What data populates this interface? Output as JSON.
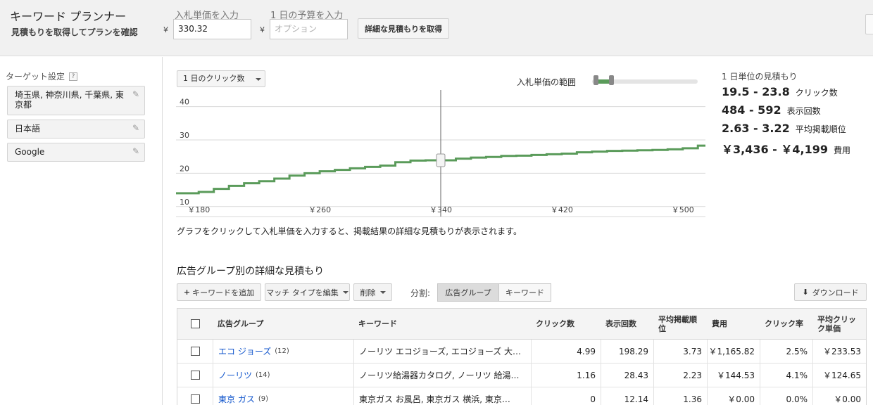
{
  "header": {
    "title": "キーワード プランナー",
    "subtitle": "見積もりを取得してプランを確認",
    "bid_label": "入札単価を入力",
    "budget_label": "1 日の予算を入力",
    "currency": "¥",
    "bid_value": "330.32",
    "budget_placeholder": "オプション",
    "detail_button": "詳細な見積もりを取得"
  },
  "sidebar": {
    "heading": "ターゲット設定",
    "help": "?",
    "items": [
      {
        "label": "埼玉県, 神奈川県, 千葉県, 東京都"
      },
      {
        "label": "日本語"
      },
      {
        "label": "Google"
      }
    ]
  },
  "controls": {
    "metric_dropdown": "1 日のクリック数",
    "range_label": "入札単価の範囲",
    "range_min_fraction": 0.03,
    "range_max_fraction": 0.18
  },
  "chart_data": {
    "type": "line",
    "title": "",
    "xlabel": "",
    "ylabel": "",
    "xlim": [
      165,
      515
    ],
    "ylim": [
      7,
      45
    ],
    "x_tick_labels": [
      "￥180",
      "￥260",
      "￥340",
      "￥420",
      "￥500"
    ],
    "x_ticks": [
      180,
      260,
      340,
      420,
      500
    ],
    "y_ticks": [
      10,
      20,
      30,
      40
    ],
    "grid": true,
    "current_bid": 340,
    "color": "#5a9b5a",
    "series": [
      {
        "x": [
          165,
          180,
          190,
          200,
          210,
          220,
          230,
          240,
          250,
          260,
          270,
          280,
          290,
          300,
          310,
          320,
          330,
          340,
          350,
          360,
          370,
          380,
          390,
          400,
          410,
          420,
          430,
          440,
          450,
          460,
          470,
          480,
          490,
          500,
          510,
          515
        ],
        "values": [
          14.0,
          14.4,
          15.3,
          16.2,
          17.0,
          17.6,
          18.4,
          19.3,
          20.0,
          20.6,
          21.0,
          21.5,
          21.9,
          22.3,
          23.3,
          23.8,
          23.9,
          23.9,
          24.4,
          24.7,
          24.9,
          25.2,
          25.3,
          25.5,
          25.7,
          25.9,
          26.3,
          26.5,
          26.7,
          26.8,
          26.9,
          27.0,
          27.2,
          27.5,
          28.3,
          28.5
        ]
      }
    ]
  },
  "chart_hint": "グラフをクリックして入札単価を入力すると、掲載結果の詳細な見積もりが表示されます。",
  "estimates": {
    "title": "1 日単位の見積もり",
    "rows": [
      {
        "value": "19.5 - 23.8",
        "unit": "クリック数"
      },
      {
        "value": "484 - 592",
        "unit": "表示回数"
      },
      {
        "value": "2.63 - 3.22",
        "unit": "平均掲載順位"
      },
      {
        "value": "￥3,436 - ￥4,199",
        "unit": "費用"
      }
    ]
  },
  "table_section": {
    "title": "広告グループ別の詳細な見積もり",
    "add_keyword": "キーワードを追加",
    "edit_match": "マッチ タイプを編集",
    "delete": "削除",
    "split_label": "分割:",
    "seg_adgroup": "広告グループ",
    "seg_keyword": "キーワード",
    "download": "ダウンロード"
  },
  "table": {
    "headers": [
      "広告グループ",
      "キーワード",
      "クリック数",
      "表示回数",
      "平均掲載順位",
      "費用",
      "クリック率",
      "平均クリック単価"
    ],
    "rows": [
      {
        "group": "エコ ジョーズ",
        "count": "(12)",
        "keywords": "ノーリツ エコジョーズ, エコジョーズ 大…",
        "clicks": "4.99",
        "impressions": "198.29",
        "position": "3.73",
        "cost": "￥1,165.82",
        "ctr": "2.5%",
        "cpc": "￥233.53"
      },
      {
        "group": "ノーリツ",
        "count": "(14)",
        "keywords": "ノーリツ給湯器カタログ, ノーリツ 給湯…",
        "clicks": "1.16",
        "impressions": "28.43",
        "position": "2.23",
        "cost": "￥144.53",
        "ctr": "4.1%",
        "cpc": "￥124.65"
      },
      {
        "group": "東京 ガス",
        "count": "(9)",
        "keywords": "東京ガス お風呂, 東京ガス 横浜, 東京…",
        "clicks": "0",
        "impressions": "12.14",
        "position": "1.36",
        "cost": "￥0.00",
        "ctr": "0.0%",
        "cpc": "￥0.00"
      }
    ]
  }
}
